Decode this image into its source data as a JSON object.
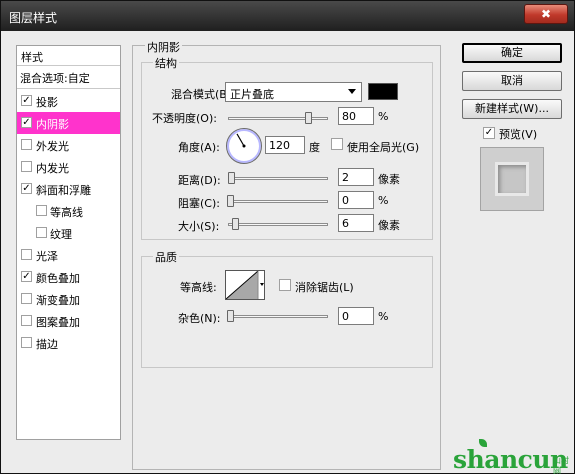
{
  "window": {
    "title": "图层样式",
    "close_label": "✖"
  },
  "style_list": {
    "header": "样式",
    "blend_options": "混合选项:自定",
    "items": [
      {
        "label": "投影",
        "checked": true
      },
      {
        "label": "内阴影",
        "checked": true,
        "active": true
      },
      {
        "label": "外发光",
        "checked": false
      },
      {
        "label": "内发光",
        "checked": false
      },
      {
        "label": "斜面和浮雕",
        "checked": true
      },
      {
        "label": "等高线",
        "checked": false,
        "sub": true
      },
      {
        "label": "纹理",
        "checked": false,
        "sub": true
      },
      {
        "label": "光泽",
        "checked": false
      },
      {
        "label": "颜色叠加",
        "checked": true
      },
      {
        "label": "渐变叠加",
        "checked": false
      },
      {
        "label": "图案叠加",
        "checked": false
      },
      {
        "label": "描边",
        "checked": false
      }
    ]
  },
  "inner_shadow": {
    "panel_title": "内阴影",
    "structure": {
      "title": "结构",
      "blend_mode_label": "混合模式(B):",
      "blend_mode_value": "正片叠底",
      "swatch_color": "#000000",
      "opacity_label": "不透明度(O):",
      "opacity_value": "80",
      "opacity_unit": "%",
      "opacity_level": 0.8,
      "angle_label": "角度(A):",
      "angle_value": "120",
      "angle_unit": "度",
      "global_light_label": "使用全局光(G)",
      "global_light_checked": false,
      "distance_label": "距离(D):",
      "distance_value": "2",
      "distance_unit": "像素",
      "choke_label": "阻塞(C):",
      "choke_value": "0",
      "choke_unit": "%",
      "size_label": "大小(S):",
      "size_value": "6",
      "size_unit": "像素"
    },
    "quality": {
      "title": "品质",
      "contour_label": "等高线:",
      "antialias_label": "消除锯齿(L)",
      "antialias_checked": false,
      "noise_label": "杂色(N):",
      "noise_value": "0",
      "noise_unit": "%"
    }
  },
  "buttons": {
    "ok": "确定",
    "cancel": "取消",
    "new_style": "新建样式(W)...",
    "preview_label": "预览(V)",
    "preview_checked": true
  },
  "watermark": {
    "text": "shancun",
    "small": "山村网"
  }
}
